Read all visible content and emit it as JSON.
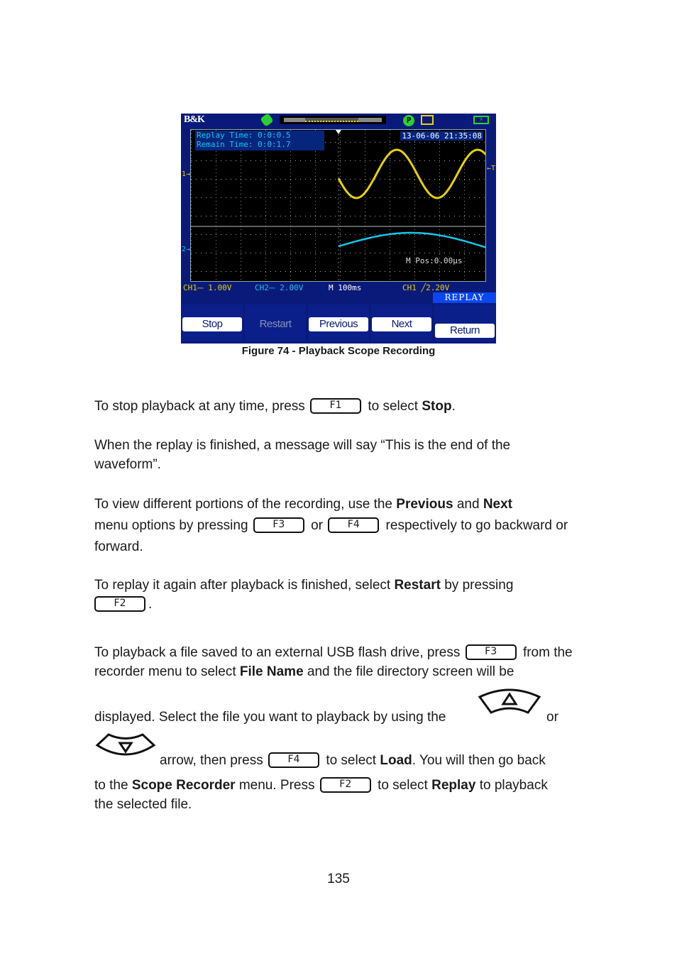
{
  "scope": {
    "brand": "B&K",
    "replay_time": "Replay Time: 0:0:0.5",
    "remain_time": "Remain Time: 0:0:1.7",
    "datetime": "13-06-06 21:35:08",
    "m_pos": "M Pos:0.00µs",
    "ch1_marker": "1→",
    "ch2_marker": "2→",
    "trigger_marker": "←T",
    "status": {
      "ch1": "CH1⎓ 1.00V",
      "ch2": "CH2⎓ 2.00V",
      "timebase": "M 100ms",
      "trigger": "CH1 ╱2.20V"
    },
    "menu_title": "REPLAY",
    "softkeys": [
      {
        "label": "Stop",
        "enabled": true
      },
      {
        "label": "Restart",
        "enabled": false
      },
      {
        "label": "Previous",
        "enabled": true
      },
      {
        "label": "Next",
        "enabled": true
      },
      {
        "label": "Return",
        "enabled": true
      }
    ],
    "colors": {
      "ch1": "#e6d200",
      "ch2": "#17c6e8",
      "background": "#0a1a7a"
    }
  },
  "caption": "Figure 74 - Playback Scope Recording",
  "paragraphs": {
    "p1": {
      "a": "To stop playback at any time, press",
      "key": "F1",
      "b": "to select",
      "bold": "Stop",
      "c": "."
    },
    "p2": {
      "text": "When the replay is finished, a message will say “This is the end of the waveform”."
    },
    "p3": {
      "a": "To view different portions of the recording, use the",
      "bold1": "Previous",
      "and": "and",
      "bold2": "Next",
      "b": "menu options by pressing",
      "key1": "F3",
      "or": "or",
      "key2": "F4",
      "c": "respectively to go backward or forward."
    },
    "p4": {
      "a": "To replay it again after playback is finished, select",
      "bold": "Restart",
      "b": "by pressing",
      "key": "F2",
      "c": "."
    },
    "p5": {
      "a": "To playback a file saved to an external USB flash drive, press",
      "key1": "F3",
      "b": "from the recorder menu to select",
      "bold1": "File Name",
      "c": "and the file directory screen will be",
      "d": "displayed.  Select the file you want to playback by using the",
      "or": "or",
      "e": "arrow, then press",
      "key2": "F4",
      "f": "to select",
      "bold2": "Load",
      "g": ".  You will then go back",
      "h": "to the",
      "bold3": "Scope Recorder",
      "i": "menu.  Press",
      "key3": "F2",
      "j": "to select",
      "bold4": "Replay",
      "k": "to playback",
      "l": "the selected file."
    }
  },
  "page_number": "135"
}
